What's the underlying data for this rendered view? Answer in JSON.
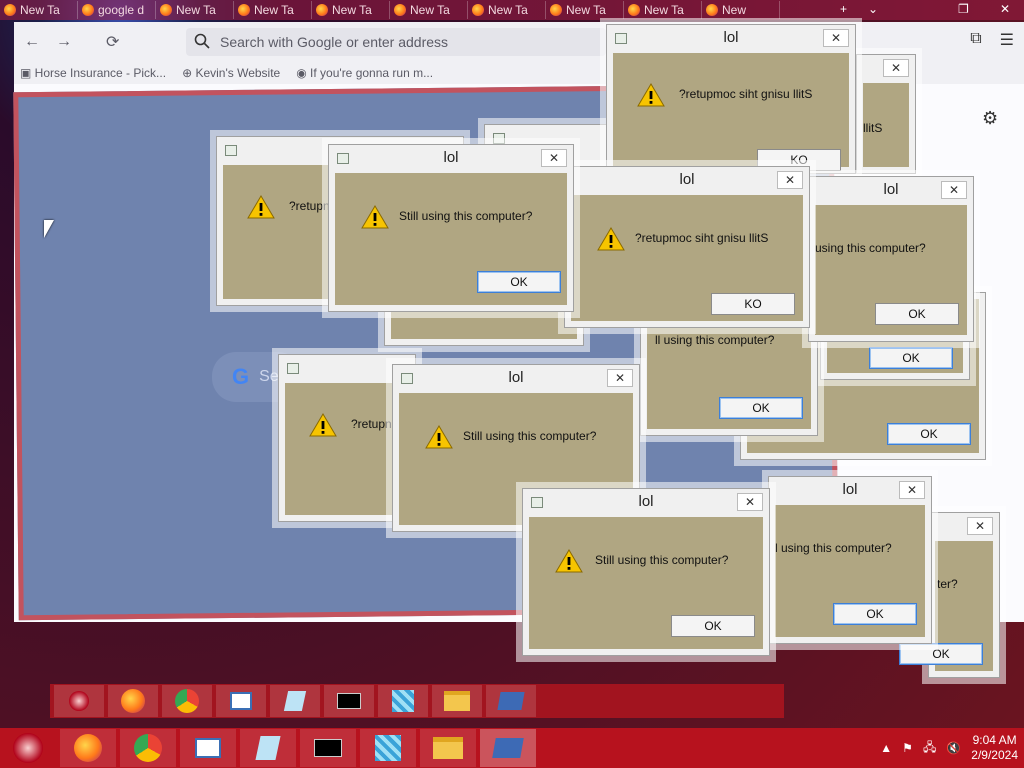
{
  "tabs": [
    {
      "label": "New Ta"
    },
    {
      "label": "google d"
    },
    {
      "label": "New Ta"
    },
    {
      "label": "New Ta"
    },
    {
      "label": "New Ta"
    },
    {
      "label": "New Ta"
    },
    {
      "label": "New Ta"
    },
    {
      "label": "New Ta"
    },
    {
      "label": "New Ta"
    },
    {
      "label": "New"
    }
  ],
  "browser": {
    "url_placeholder": "Search with Google or enter address",
    "bookmarks": [
      "Horse Insurance - Pick...",
      "Kevin's Website",
      "If you're gonna run m..."
    ],
    "google_search_stub": "Se"
  },
  "dialogs": [
    {
      "title": "",
      "msg": "?retupn",
      "ok": ""
    },
    {
      "title": "",
      "msg": "",
      "ok": ""
    },
    {
      "title": "lol",
      "msg": "?retupmoc siht gnisu llitS",
      "ok": "KO"
    },
    {
      "title": "lol",
      "msg": "llitS",
      "ok": ""
    },
    {
      "title": "lol",
      "msg": "Still using this computer?",
      "ok": "OK"
    },
    {
      "title": "lol",
      "msg": "?retupmoc siht gnisu llitS",
      "ok": "KO"
    },
    {
      "title": "lol",
      "msg": "using this computer?",
      "ok": "OK"
    },
    {
      "title": "",
      "msg": "",
      "ok": "OK"
    },
    {
      "title": "",
      "msg": "ll using this computer?",
      "ok": "OK"
    },
    {
      "title": "",
      "msg": "",
      "ok": "OK"
    },
    {
      "title": "",
      "msg": "?retupn",
      "ok": ""
    },
    {
      "title": "lol",
      "msg": "Still using this computer?",
      "ok": ""
    },
    {
      "title": "lol",
      "msg": "Still using this computer?",
      "ok": "OK"
    },
    {
      "title": "lol",
      "msg": "l using this computer?",
      "ok": "OK"
    },
    {
      "title": "",
      "msg": "ter?",
      "ok": "OK"
    }
  ],
  "taskbar": {
    "time": "9:04 AM",
    "date": "2/9/2024",
    "icons": [
      "start-orb",
      "firefox",
      "chrome",
      "file-manager",
      "notepad",
      "cmd",
      "registry",
      "folder",
      "powershell"
    ]
  },
  "colors": {
    "dialog_body": "#b0a682",
    "taskbar": "#b7121e",
    "blue_pane": "#6f83ae",
    "frame_border": "#c2535e"
  }
}
